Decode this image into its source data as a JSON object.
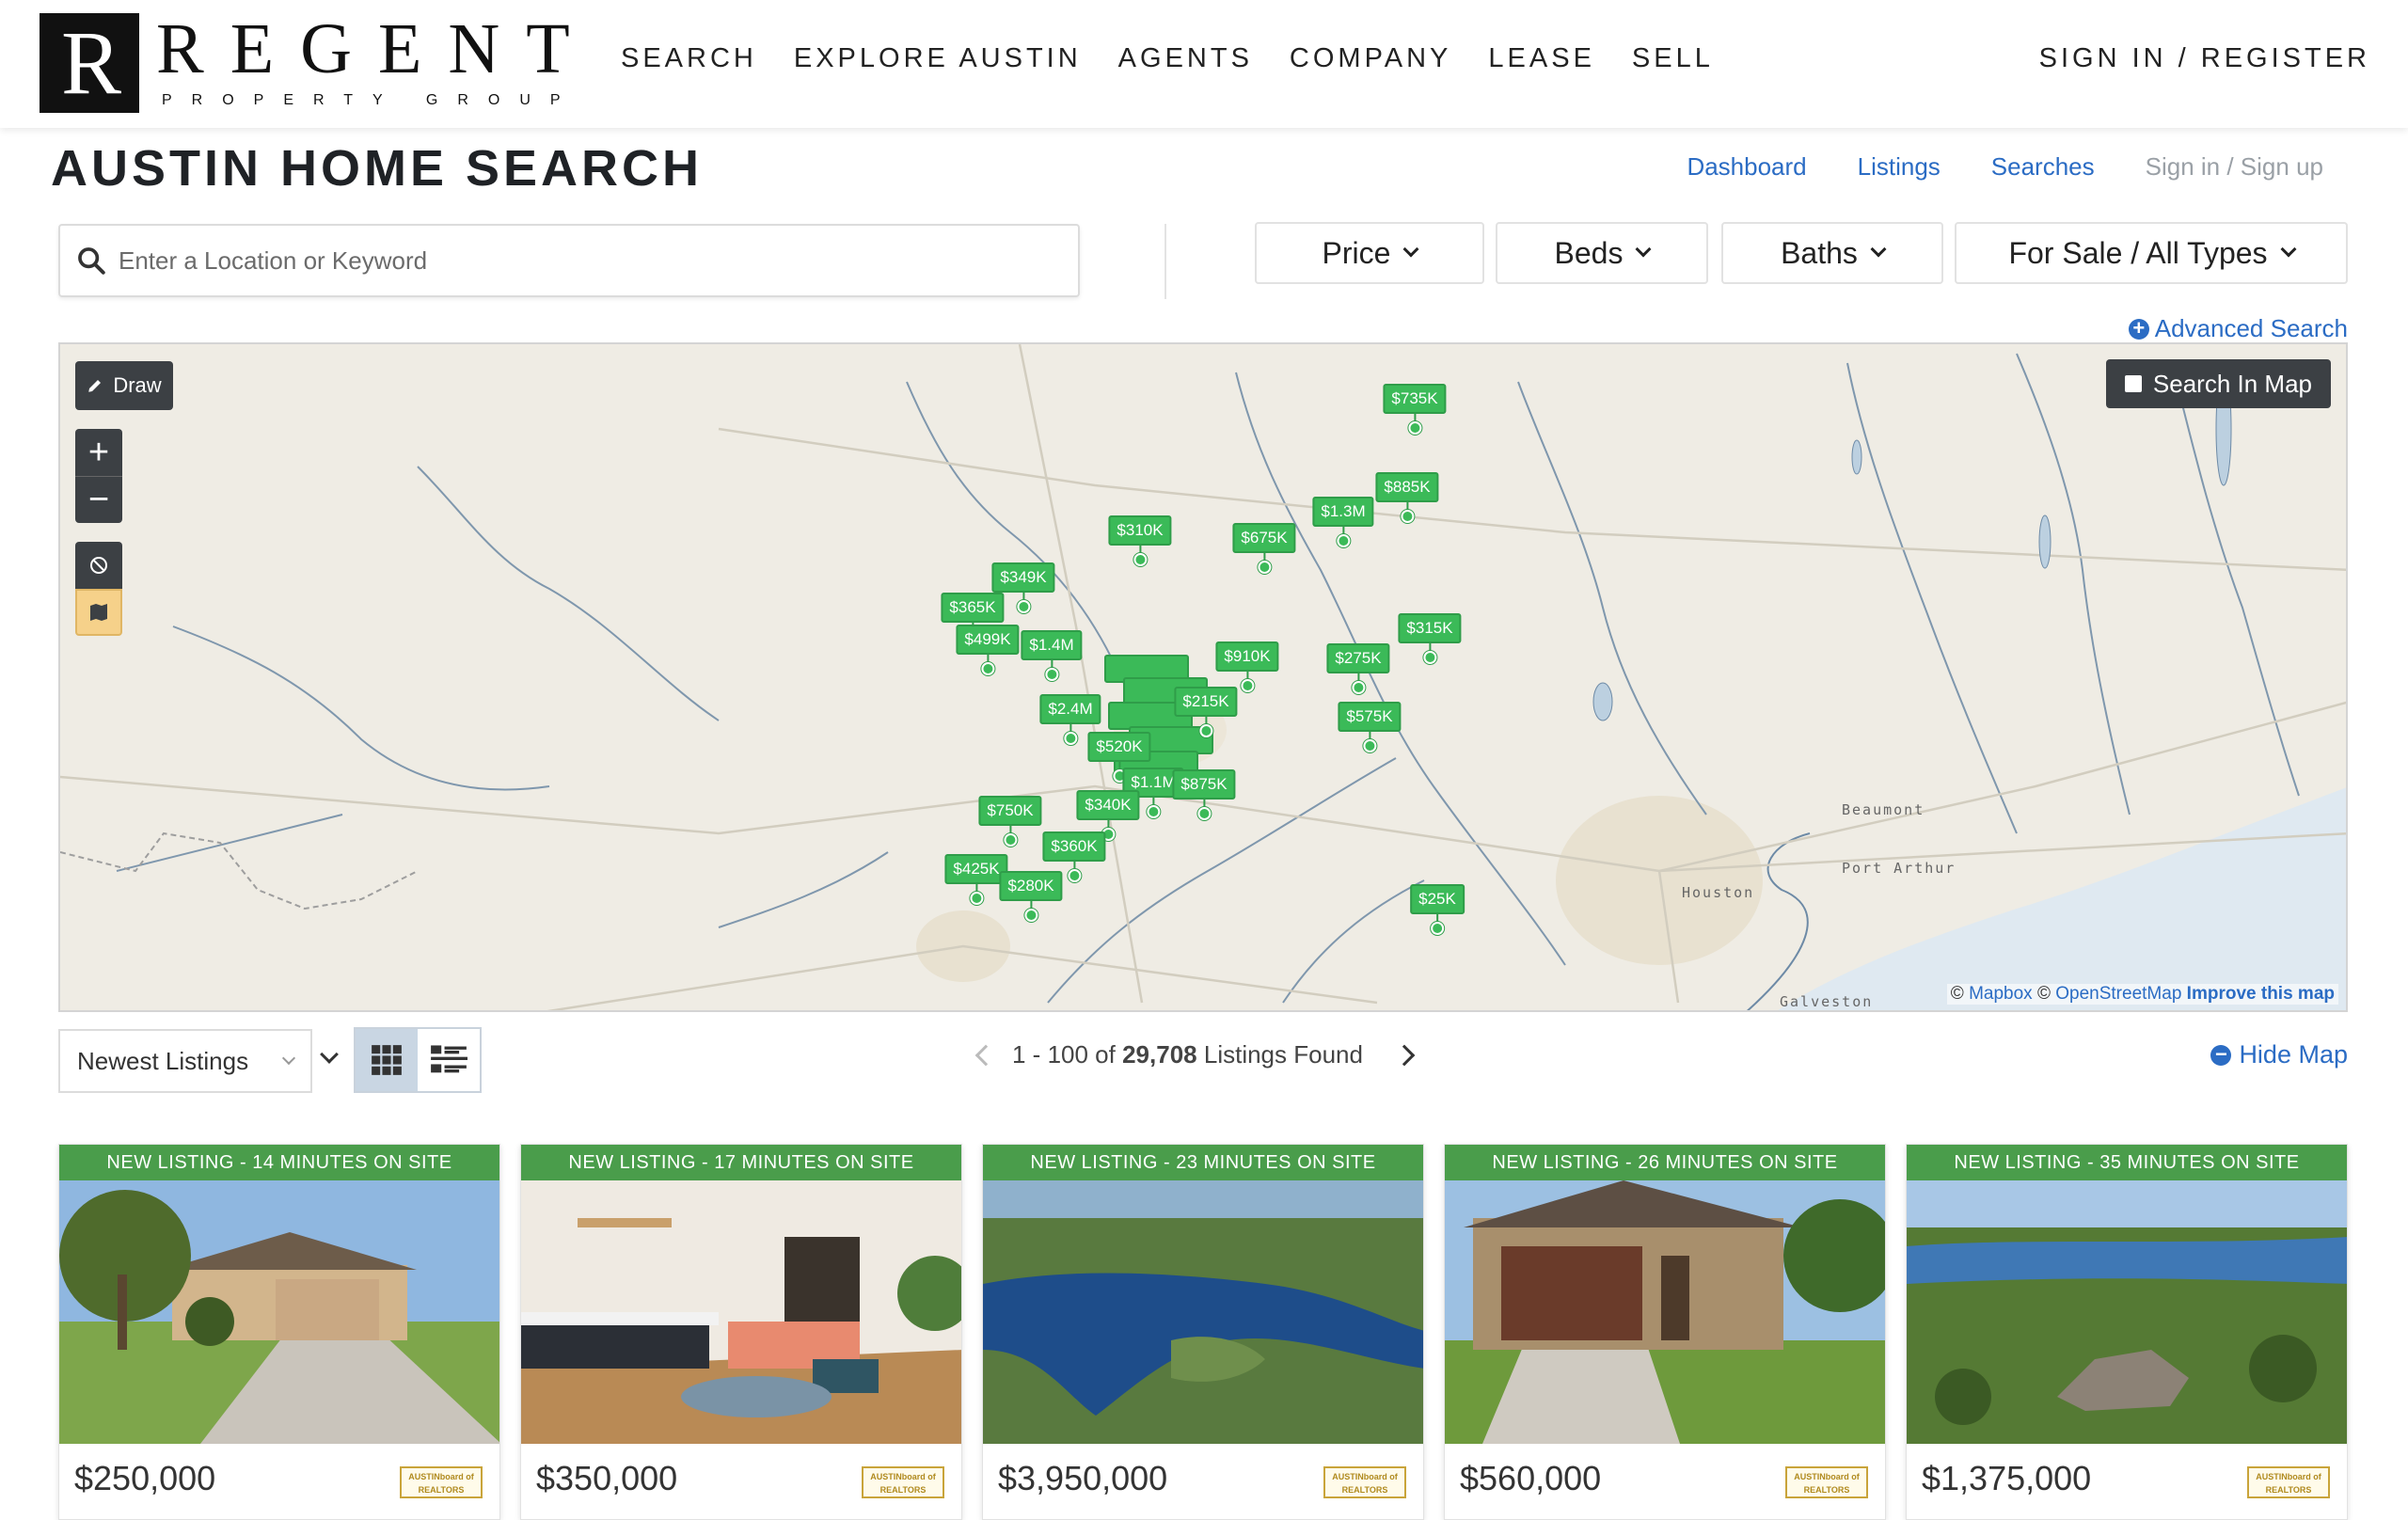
{
  "header": {
    "logo_mark": "R",
    "logo_word": "REGENT",
    "logo_sub": "PROPERTY GROUP",
    "nav": [
      "SEARCH",
      "EXPLORE AUSTIN",
      "AGENTS",
      "COMPANY",
      "LEASE",
      "SELL"
    ],
    "signin": "SIGN IN / REGISTER"
  },
  "title": "AUSTIN HOME SEARCH",
  "sublinks": [
    "Dashboard",
    "Listings",
    "Searches",
    "Sign in / Sign up"
  ],
  "search": {
    "placeholder": "Enter a Location or Keyword"
  },
  "filters": [
    "Price",
    "Beds",
    "Baths",
    "For Sale / All Types"
  ],
  "advanced_search": "Advanced Search",
  "map": {
    "draw": "Draw",
    "search_in_map": "Search In Map",
    "attribution": {
      "mapbox": "Mapbox",
      "osm": "OpenStreetMap",
      "improve": "Improve this map"
    },
    "cities": [
      "Beaumont",
      "Port Arthur",
      "Houston",
      "Galveston"
    ],
    "pins": [
      "$735K",
      "$885K",
      "$1.3M",
      "$310K",
      "$675K",
      "$349K",
      "$365K",
      "$499K",
      "$1.4M",
      "$910K",
      "$315K",
      "$275K",
      "$215K",
      "$2.4M",
      "$575K",
      "$520K",
      "$1.1M",
      "$875K",
      "$340K",
      "$750K",
      "$360K",
      "$425K",
      "$280K",
      "$25K"
    ]
  },
  "results": {
    "sort": "Newest Listings",
    "range": "1 - 100 of",
    "total": "29,708",
    "suffix": "Listings Found",
    "hide_map": "Hide Map"
  },
  "cards": [
    {
      "banner": "NEW LISTING - 14 MINUTES ON SITE",
      "price": "$250,000"
    },
    {
      "banner": "NEW LISTING - 17 MINUTES ON SITE",
      "price": "$350,000"
    },
    {
      "banner": "NEW LISTING - 23 MINUTES ON SITE",
      "price": "$3,950,000"
    },
    {
      "banner": "NEW LISTING - 26 MINUTES ON SITE",
      "price": "$560,000"
    },
    {
      "banner": "NEW LISTING - 35 MINUTES ON SITE",
      "price": "$1,375,000"
    }
  ],
  "board_logo": "AUSTINboard of REALTORS",
  "colors": {
    "accent": "#2b6cc4",
    "pin": "#3bba58",
    "banner": "#4a9d4b"
  }
}
